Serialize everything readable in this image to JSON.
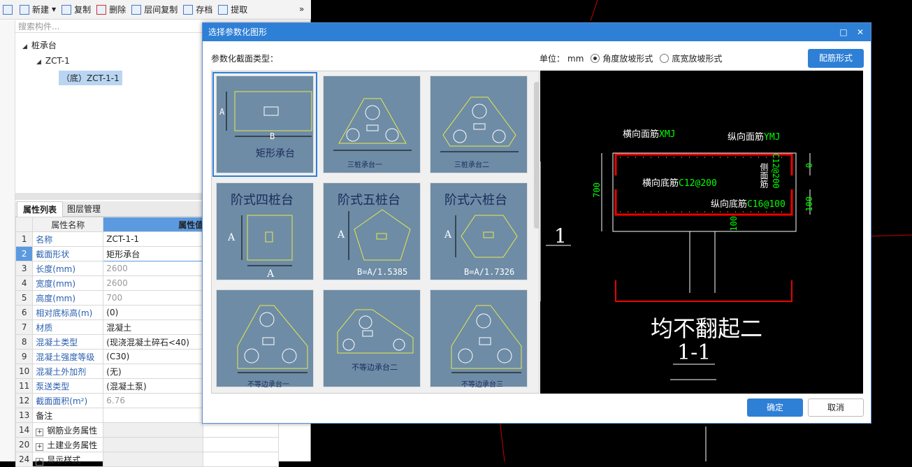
{
  "toolbar": {
    "new": "新建",
    "copy": "复制",
    "delete": "删除",
    "floor_copy": "层间复制",
    "save": "存档",
    "extract": "提取",
    "more": "»"
  },
  "search": {
    "placeholder": "搜索构件..."
  },
  "tree": {
    "root": "桩承台",
    "child": "ZCT-1",
    "leaf": "（底）ZCT-1-1"
  },
  "tabs": {
    "props": "属性列表",
    "layers": "图层管理"
  },
  "props": {
    "col_name": "属性名称",
    "col_value": "属性值",
    "rows": [
      {
        "n": "1",
        "k": "名称",
        "v": "ZCT-1-1"
      },
      {
        "n": "2",
        "k": "截面形状",
        "v": "矩形承台"
      },
      {
        "n": "3",
        "k": "长度(mm)",
        "v": "2600"
      },
      {
        "n": "4",
        "k": "宽度(mm)",
        "v": "2600"
      },
      {
        "n": "5",
        "k": "高度(mm)",
        "v": "700"
      },
      {
        "n": "6",
        "k": "相对底标高(m)",
        "v": "(0)"
      },
      {
        "n": "7",
        "k": "材质",
        "v": "混凝土"
      },
      {
        "n": "8",
        "k": "混凝土类型",
        "v": "(现浇混凝土碎石<40)"
      },
      {
        "n": "9",
        "k": "混凝土强度等级",
        "v": "(C30)"
      },
      {
        "n": "10",
        "k": "混凝土外加剂",
        "v": "(无)"
      },
      {
        "n": "11",
        "k": "泵送类型",
        "v": "(混凝土泵)"
      },
      {
        "n": "12",
        "k": "截面面积(m²)",
        "v": "6.76"
      },
      {
        "n": "13",
        "k": "备注",
        "v": ""
      },
      {
        "n": "14",
        "k": "钢筋业务属性",
        "v": ""
      },
      {
        "n": "20",
        "k": "土建业务属性",
        "v": ""
      },
      {
        "n": "24",
        "k": "显示样式",
        "v": ""
      }
    ]
  },
  "dialog": {
    "title": "选择参数化图形",
    "section_type": "参数化截面类型：",
    "unit_label": "单位：",
    "unit_value": "mm",
    "radio1": "角度放坡形式",
    "radio2": "底宽放坡形式",
    "rebar_button": "配筋形式",
    "ok": "确定",
    "cancel": "取消"
  },
  "shapes": {
    "rect": "矩形承台",
    "three1": "三桩承台一",
    "three2": "三桩承台二",
    "step4": "阶式四桩台",
    "step5": "阶式五桩台",
    "step6": "阶式六桩台",
    "step5_formula": "B=A/1.5385",
    "step6_formula": "B=A/1.7326",
    "uneq1": "不等边承台一",
    "uneq2": "不等边承台二",
    "uneq3": "不等边承台三",
    "dim_a": "A",
    "dim_b": "B"
  },
  "preview": {
    "h_top": "横向面筋",
    "h_top_code": "XMJ",
    "v_top": "纵向面筋",
    "v_top_code": "YMJ",
    "h_bot": "横向底筋",
    "h_bot_code": "C12@200",
    "v_bot": "纵向底筋",
    "v_bot_code": "C16@100",
    "side": "侧面筋",
    "side_code": "C12@200",
    "dim_700": "700",
    "dim_100a": "100",
    "dim_100b": "100",
    "dim_0": "0",
    "caption": "均不翻起二",
    "section": "1-1",
    "bg_label": "1"
  }
}
